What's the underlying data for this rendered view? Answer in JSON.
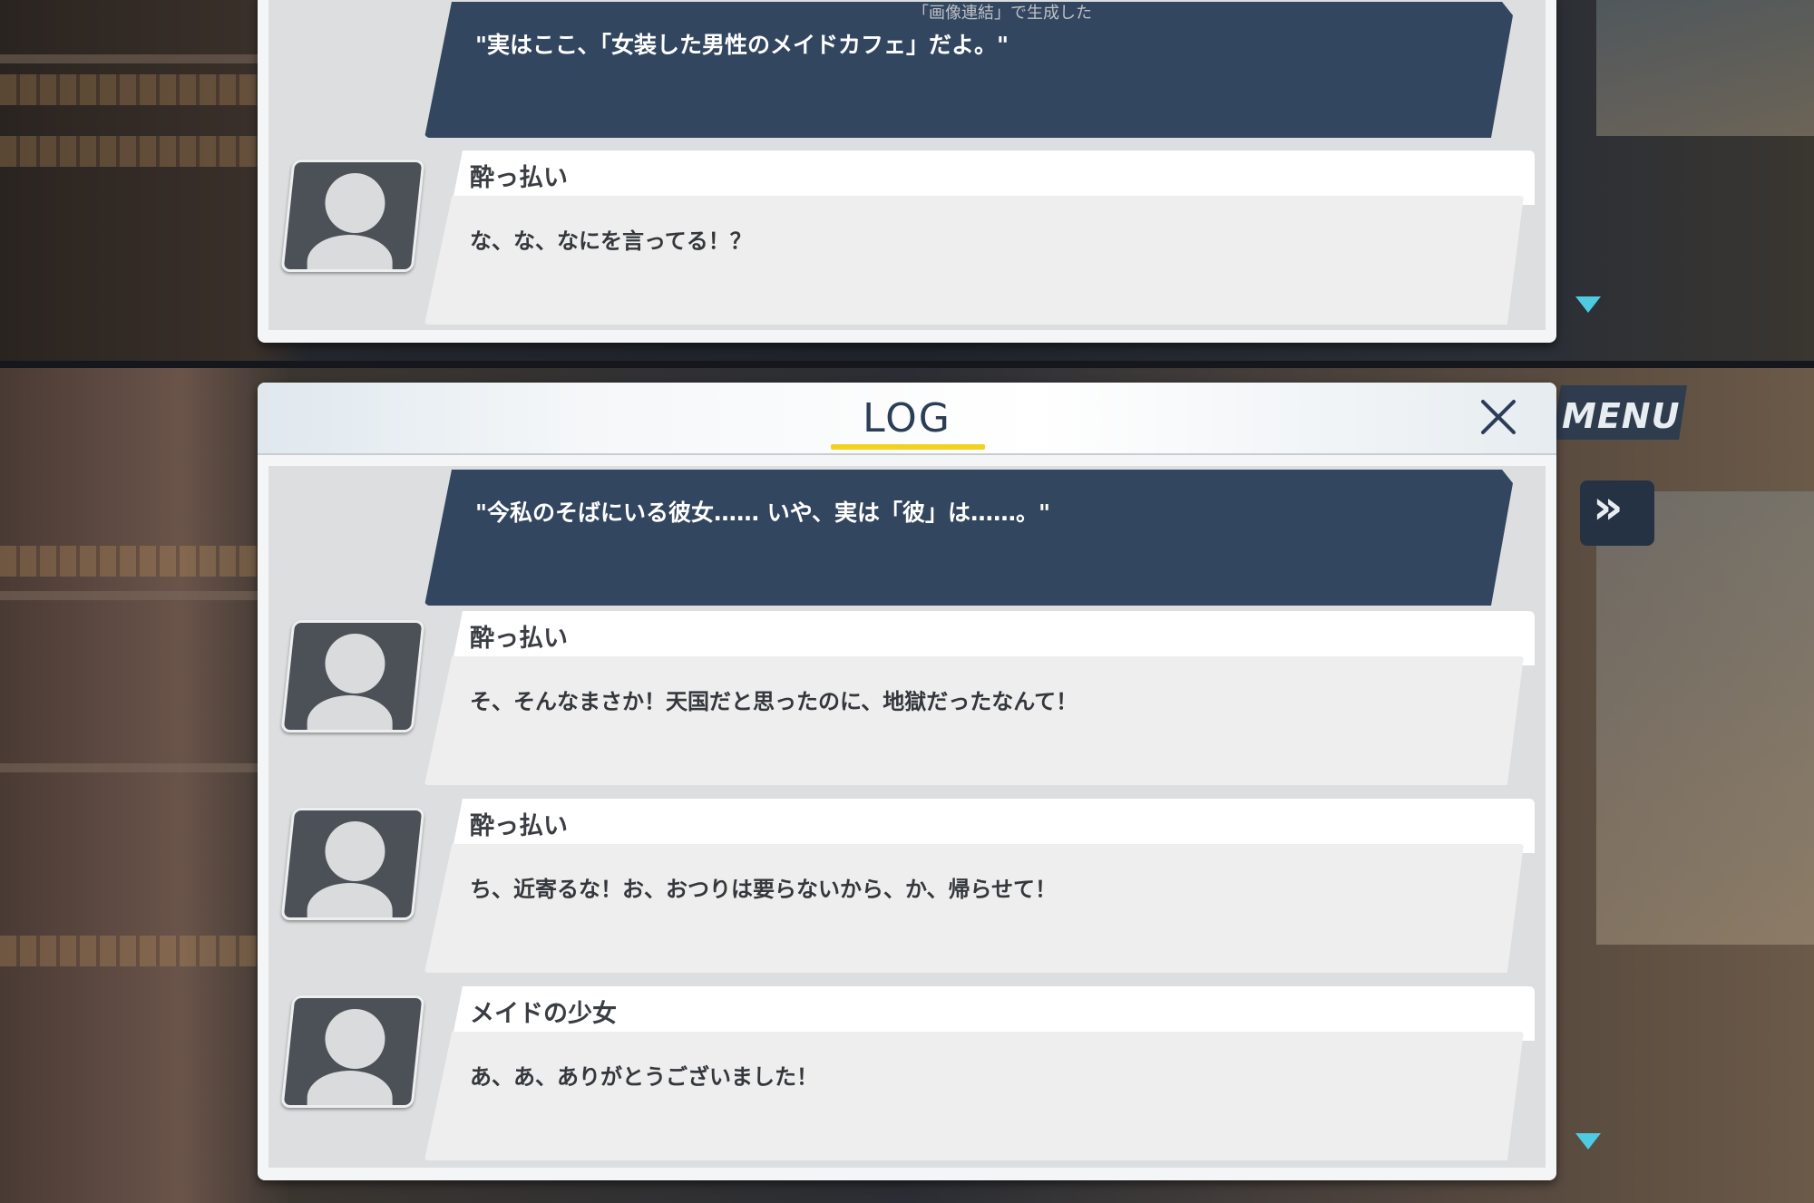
{
  "watermark": "「画像連結」で生成した",
  "top_screen": {
    "narration": "\"実はここ、「女装した男性のメイドカフェ」だよ。\"",
    "entries": [
      {
        "speaker": "酔っ払い",
        "message": "な、な、なにを言ってる！？"
      }
    ]
  },
  "log": {
    "title": "LOG",
    "narration": "\"今私のそばにいる彼女…… いや、実は「彼」は……。\"",
    "entries": [
      {
        "speaker": "酔っ払い",
        "message": "そ、そんなまさか！天国だと思ったのに、地獄だったなんて！"
      },
      {
        "speaker": "酔っ払い",
        "message": "ち、近寄るな！お、おつりは要らないから、か、帰らせて！"
      },
      {
        "speaker": "メイドの少女",
        "message": "あ、あ、ありがとうございました！"
      }
    ]
  },
  "controls": {
    "menu_label": "MENU",
    "skip_glyph": "»"
  },
  "icons": {
    "close": "close-icon",
    "avatar": "avatar-placeholder-icon",
    "next": "next-arrow-icon",
    "skip": "fast-forward-icon"
  },
  "colors": {
    "narration_bg": "#33465f",
    "title_text": "#2c3e57",
    "title_underline": "#f3d21e",
    "next_arrow": "#4ecbe0"
  }
}
